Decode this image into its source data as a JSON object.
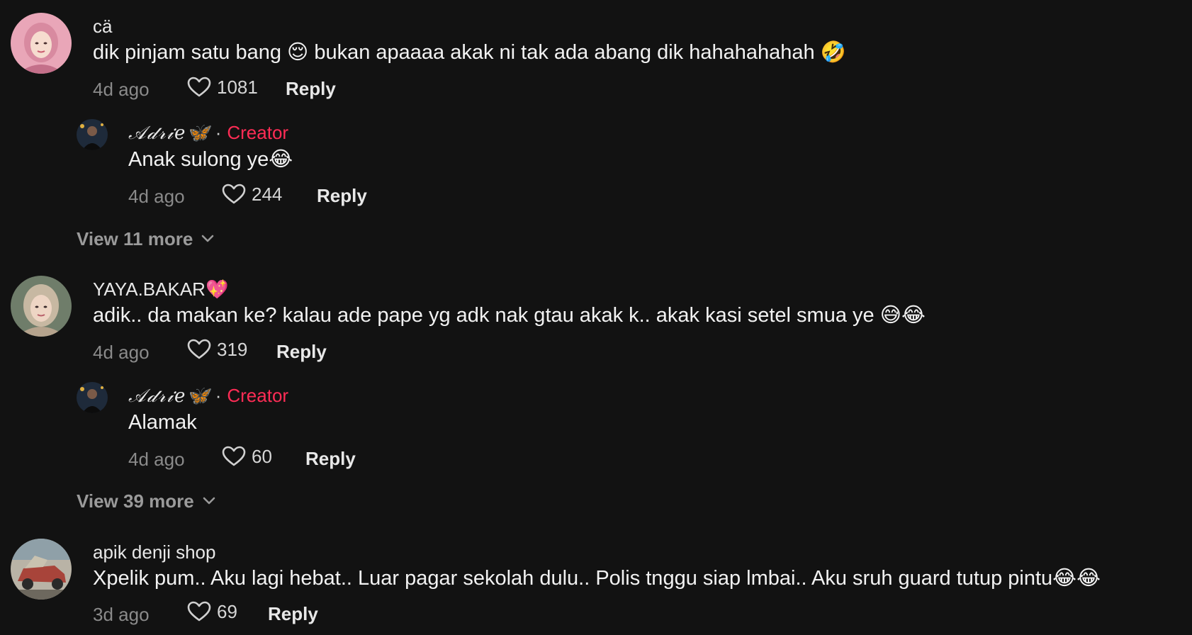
{
  "comments": [
    {
      "avatar_icon": "user-avatar-pink-hijab",
      "username": "cä",
      "text": "dik pinjam satu bang 😌 bukan apaaaa akak ni tak ada abang dik hahahahahah 🤣",
      "time": "4d ago",
      "likes": "1081",
      "reply_label": "Reply",
      "reply": {
        "avatar_icon": "creator-avatar",
        "username": "𝒜𝒹𝓇𝒾𝑒🦋",
        "separator": "·",
        "badge": "Creator",
        "text": "Anak sulong ye😂",
        "time": "4d ago",
        "likes": "244",
        "reply_label": "Reply"
      },
      "view_more": "View 11 more"
    },
    {
      "avatar_icon": "user-avatar-beige-hijab",
      "username": "YAYA.BAKAR💖",
      "text": "adik.. da makan ke? kalau ade pape yg adk nak gtau akak k.. akak kasi setel smua ye 😅😂",
      "time": "4d ago",
      "likes": "319",
      "reply_label": "Reply",
      "reply": {
        "avatar_icon": "creator-avatar",
        "username": "𝒜𝒹𝓇𝒾𝑒🦋",
        "separator": "·",
        "badge": "Creator",
        "text": "Alamak",
        "time": "4d ago",
        "likes": "60",
        "reply_label": "Reply"
      },
      "view_more": "View 39 more"
    },
    {
      "avatar_icon": "user-avatar-car",
      "username": "apik denji shop",
      "text": "Xpelik pum.. Aku lagi hebat.. Luar pagar sekolah dulu.. Polis tnggu siap lmbai.. Aku sruh guard tutup pintu😂😂",
      "time": "3d ago",
      "likes": "69",
      "reply_label": "Reply"
    }
  ],
  "colors": {
    "background": "#121212",
    "creator_badge": "#fe2c55",
    "muted": "#8a8a8a"
  }
}
